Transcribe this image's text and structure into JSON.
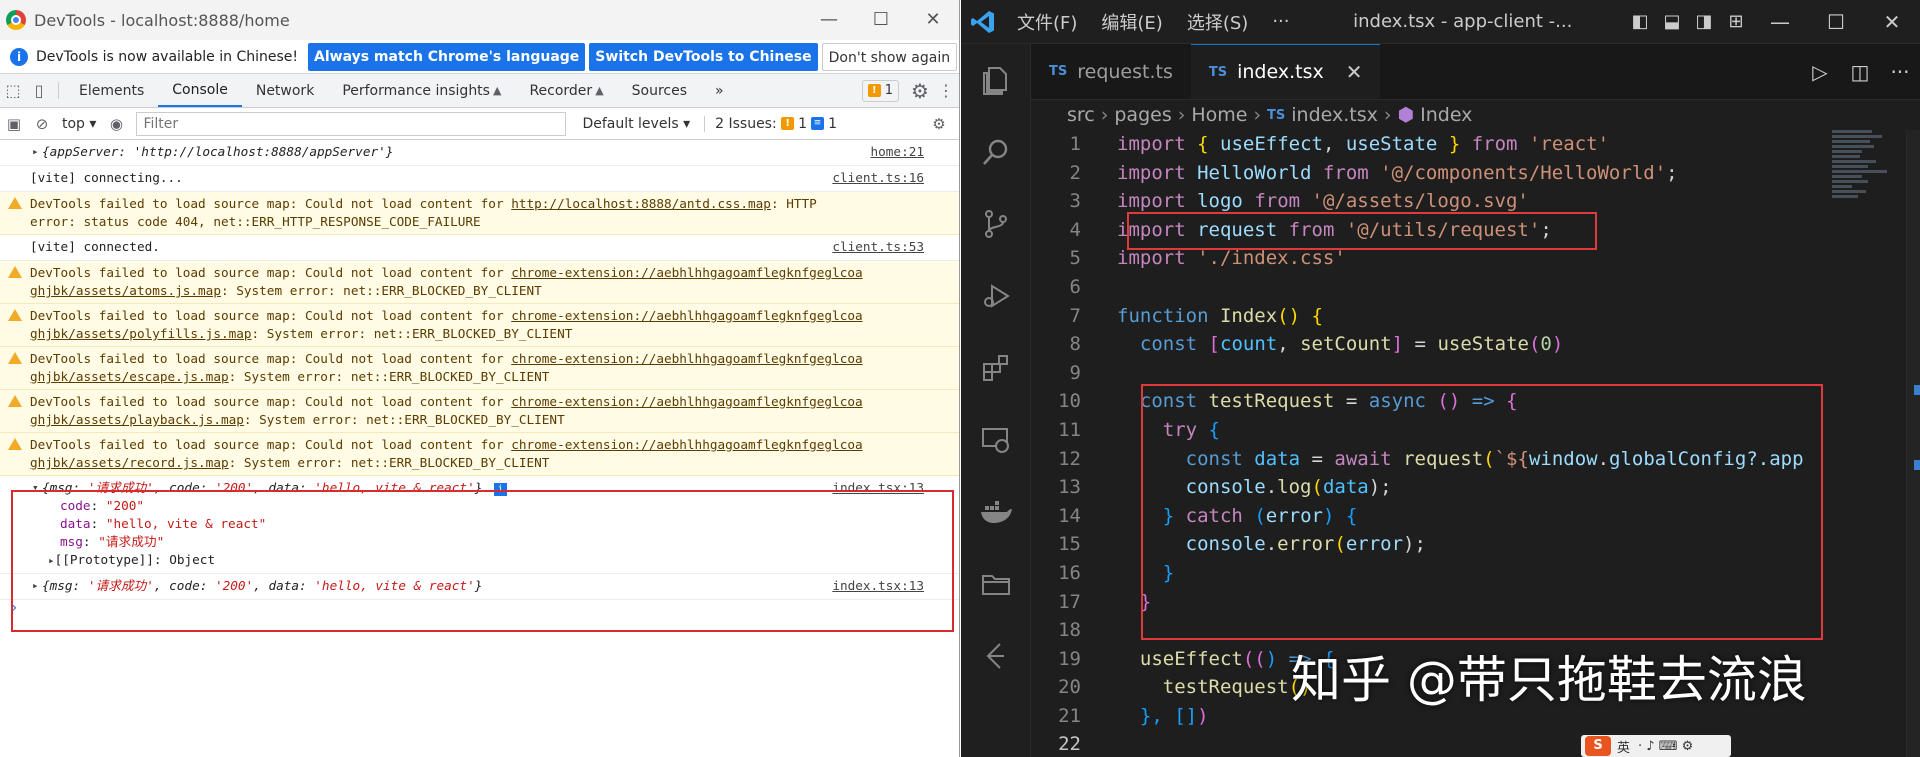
{
  "devtools": {
    "window_title": "DevTools - localhost:8888/home",
    "infobar": {
      "message": "DevTools is now available in Chinese!",
      "btn_match": "Always match Chrome's language",
      "btn_switch": "Switch DevTools to Chinese",
      "btn_dismiss": "Don't show again"
    },
    "tabs": [
      "Elements",
      "Console",
      "Network",
      "Performance insights",
      "Recorder",
      "Sources"
    ],
    "active_tab": "Console",
    "issue_badge_count": "1",
    "toolbar": {
      "context": "top",
      "filter_placeholder": "Filter",
      "levels": "Default levels",
      "issues_label": "2 Issues:",
      "issues_warn": "1",
      "issues_info": "1"
    },
    "log": {
      "app_server": {
        "text": "{appServer: 'http://localhost:8888/appServer'}",
        "src": "home:21"
      },
      "connecting": {
        "text": "[vite] connecting...",
        "src": "client.ts:16"
      },
      "antd_warn": {
        "prefix": "DevTools failed to load source map: Could not load content for ",
        "url": "http://localhost:8888/antd.css.map",
        "tail1": ": HTTP",
        "line2": "error: status code 404, net::ERR_HTTP_RESPONSE_CODE_FAILURE"
      },
      "connected": {
        "text": "[vite] connected.",
        "src": "client.ts:53"
      },
      "ext_prefix": "DevTools failed to load source map: Could not load content for ",
      "ext_url1": "chrome-extension://aebhlhhgagoamflegknfgeglcoa",
      "ext_error": ": System error: net::ERR_BLOCKED_BY_CLIENT",
      "ext_maps": [
        "ghjbk/assets/atoms.js.map",
        "ghjbk/assets/polyfills.js.map",
        "ghjbk/assets/escape.js.map",
        "ghjbk/assets/playback.js.map",
        "ghjbk/assets/record.js.map"
      ],
      "response": {
        "summary_open": "{msg: ",
        "msg": "'请求成功'",
        "code_key": ", code: ",
        "code": "'200'",
        "data_key": ", data: ",
        "data": "'hello, vite & react'",
        "close": "}",
        "src": "index.tsx:13",
        "props": [
          {
            "key": "code",
            "value": "\"200\""
          },
          {
            "key": "data",
            "value": "\"hello, vite & react\""
          },
          {
            "key": "msg",
            "value": "\"请求成功\""
          }
        ],
        "prototype": "[[Prototype]]: Object"
      }
    }
  },
  "vscode": {
    "menus": [
      "文件(F)",
      "编辑(E)",
      "选择(S)",
      "···"
    ],
    "doc_title": "index.tsx - app-client -...",
    "tabs": [
      {
        "lang": "TS",
        "name": "request.ts"
      },
      {
        "lang": "TS",
        "name": "index.tsx"
      }
    ],
    "breadcrumb": [
      "src",
      "pages",
      "Home",
      "index.tsx",
      "Index"
    ],
    "breadcrumb_lang": "TS",
    "line_numbers": [
      "1",
      "2",
      "3",
      "4",
      "5",
      "6",
      "7",
      "8",
      "9",
      "10",
      "11",
      "12",
      "13",
      "14",
      "15",
      "16",
      "17",
      "18",
      "19",
      "20",
      "21",
      "22"
    ],
    "code": {
      "l1": [
        "import",
        "{",
        "useEffect",
        ",",
        "useState",
        "}",
        "from",
        "'react'"
      ],
      "l2": [
        "import",
        "HelloWorld",
        "from",
        "'@/components/HelloWorld'",
        ";"
      ],
      "l3": [
        "import",
        "logo",
        "from",
        "'@/assets/logo.svg'"
      ],
      "l4": [
        "import",
        "request",
        "from",
        "'@/utils/request'",
        ";"
      ],
      "l5": [
        "import",
        "'./index.css'"
      ],
      "l7": [
        "function",
        "Index",
        "()",
        "{"
      ],
      "l8": [
        "const",
        "[",
        "count",
        ",",
        "setCount",
        "]",
        "=",
        "useState",
        "(",
        "0",
        ")"
      ],
      "l10": [
        "const",
        "testRequest",
        "=",
        "async",
        "()",
        "=>",
        "{"
      ],
      "l11": [
        "try",
        "{"
      ],
      "l12": [
        "const",
        "data",
        "=",
        "await",
        "request",
        "(",
        "`${",
        "window",
        ".",
        "globalConfig",
        "?.app"
      ],
      "l13": [
        "console",
        ".",
        "log",
        "(",
        "data",
        ");"
      ],
      "l14": [
        "}",
        "catch",
        "(",
        "error",
        ")",
        "{"
      ],
      "l15": [
        "console",
        ".",
        "error",
        "(",
        "error",
        ");"
      ],
      "l16": [
        "}"
      ],
      "l17": [
        "}"
      ],
      "l19": [
        "useEffect",
        "((",
        ")",
        "=>",
        "{"
      ],
      "l20": [
        "testRequest",
        "()"
      ],
      "l21": [
        "},",
        "[]",
        ")"
      ]
    },
    "watermark": "知乎 @带只拖鞋去流浪",
    "ime_label": "英"
  },
  "colors": {
    "highlight_box": "#d92b2b",
    "devtools_accent": "#1a73e8",
    "vscode_bg": "#1e1e1e"
  }
}
